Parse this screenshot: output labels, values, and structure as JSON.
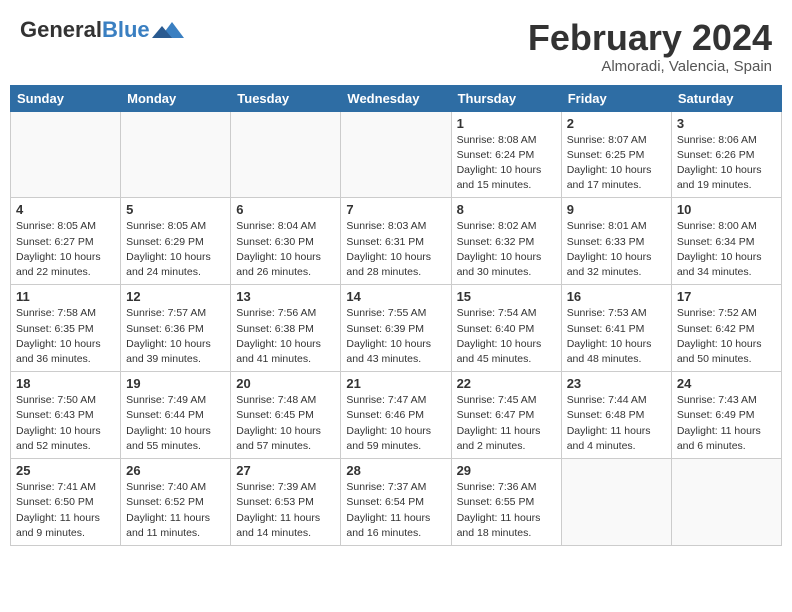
{
  "logo": {
    "general": "General",
    "blue": "Blue"
  },
  "title": "February 2024",
  "subtitle": "Almoradi, Valencia, Spain",
  "days_header": [
    "Sunday",
    "Monday",
    "Tuesday",
    "Wednesday",
    "Thursday",
    "Friday",
    "Saturday"
  ],
  "weeks": [
    [
      {
        "day": "",
        "info": ""
      },
      {
        "day": "",
        "info": ""
      },
      {
        "day": "",
        "info": ""
      },
      {
        "day": "",
        "info": ""
      },
      {
        "day": "1",
        "info": "Sunrise: 8:08 AM\nSunset: 6:24 PM\nDaylight: 10 hours\nand 15 minutes."
      },
      {
        "day": "2",
        "info": "Sunrise: 8:07 AM\nSunset: 6:25 PM\nDaylight: 10 hours\nand 17 minutes."
      },
      {
        "day": "3",
        "info": "Sunrise: 8:06 AM\nSunset: 6:26 PM\nDaylight: 10 hours\nand 19 minutes."
      }
    ],
    [
      {
        "day": "4",
        "info": "Sunrise: 8:05 AM\nSunset: 6:27 PM\nDaylight: 10 hours\nand 22 minutes."
      },
      {
        "day": "5",
        "info": "Sunrise: 8:05 AM\nSunset: 6:29 PM\nDaylight: 10 hours\nand 24 minutes."
      },
      {
        "day": "6",
        "info": "Sunrise: 8:04 AM\nSunset: 6:30 PM\nDaylight: 10 hours\nand 26 minutes."
      },
      {
        "day": "7",
        "info": "Sunrise: 8:03 AM\nSunset: 6:31 PM\nDaylight: 10 hours\nand 28 minutes."
      },
      {
        "day": "8",
        "info": "Sunrise: 8:02 AM\nSunset: 6:32 PM\nDaylight: 10 hours\nand 30 minutes."
      },
      {
        "day": "9",
        "info": "Sunrise: 8:01 AM\nSunset: 6:33 PM\nDaylight: 10 hours\nand 32 minutes."
      },
      {
        "day": "10",
        "info": "Sunrise: 8:00 AM\nSunset: 6:34 PM\nDaylight: 10 hours\nand 34 minutes."
      }
    ],
    [
      {
        "day": "11",
        "info": "Sunrise: 7:58 AM\nSunset: 6:35 PM\nDaylight: 10 hours\nand 36 minutes."
      },
      {
        "day": "12",
        "info": "Sunrise: 7:57 AM\nSunset: 6:36 PM\nDaylight: 10 hours\nand 39 minutes."
      },
      {
        "day": "13",
        "info": "Sunrise: 7:56 AM\nSunset: 6:38 PM\nDaylight: 10 hours\nand 41 minutes."
      },
      {
        "day": "14",
        "info": "Sunrise: 7:55 AM\nSunset: 6:39 PM\nDaylight: 10 hours\nand 43 minutes."
      },
      {
        "day": "15",
        "info": "Sunrise: 7:54 AM\nSunset: 6:40 PM\nDaylight: 10 hours\nand 45 minutes."
      },
      {
        "day": "16",
        "info": "Sunrise: 7:53 AM\nSunset: 6:41 PM\nDaylight: 10 hours\nand 48 minutes."
      },
      {
        "day": "17",
        "info": "Sunrise: 7:52 AM\nSunset: 6:42 PM\nDaylight: 10 hours\nand 50 minutes."
      }
    ],
    [
      {
        "day": "18",
        "info": "Sunrise: 7:50 AM\nSunset: 6:43 PM\nDaylight: 10 hours\nand 52 minutes."
      },
      {
        "day": "19",
        "info": "Sunrise: 7:49 AM\nSunset: 6:44 PM\nDaylight: 10 hours\nand 55 minutes."
      },
      {
        "day": "20",
        "info": "Sunrise: 7:48 AM\nSunset: 6:45 PM\nDaylight: 10 hours\nand 57 minutes."
      },
      {
        "day": "21",
        "info": "Sunrise: 7:47 AM\nSunset: 6:46 PM\nDaylight: 10 hours\nand 59 minutes."
      },
      {
        "day": "22",
        "info": "Sunrise: 7:45 AM\nSunset: 6:47 PM\nDaylight: 11 hours\nand 2 minutes."
      },
      {
        "day": "23",
        "info": "Sunrise: 7:44 AM\nSunset: 6:48 PM\nDaylight: 11 hours\nand 4 minutes."
      },
      {
        "day": "24",
        "info": "Sunrise: 7:43 AM\nSunset: 6:49 PM\nDaylight: 11 hours\nand 6 minutes."
      }
    ],
    [
      {
        "day": "25",
        "info": "Sunrise: 7:41 AM\nSunset: 6:50 PM\nDaylight: 11 hours\nand 9 minutes."
      },
      {
        "day": "26",
        "info": "Sunrise: 7:40 AM\nSunset: 6:52 PM\nDaylight: 11 hours\nand 11 minutes."
      },
      {
        "day": "27",
        "info": "Sunrise: 7:39 AM\nSunset: 6:53 PM\nDaylight: 11 hours\nand 14 minutes."
      },
      {
        "day": "28",
        "info": "Sunrise: 7:37 AM\nSunset: 6:54 PM\nDaylight: 11 hours\nand 16 minutes."
      },
      {
        "day": "29",
        "info": "Sunrise: 7:36 AM\nSunset: 6:55 PM\nDaylight: 11 hours\nand 18 minutes."
      },
      {
        "day": "",
        "info": ""
      },
      {
        "day": "",
        "info": ""
      }
    ]
  ]
}
